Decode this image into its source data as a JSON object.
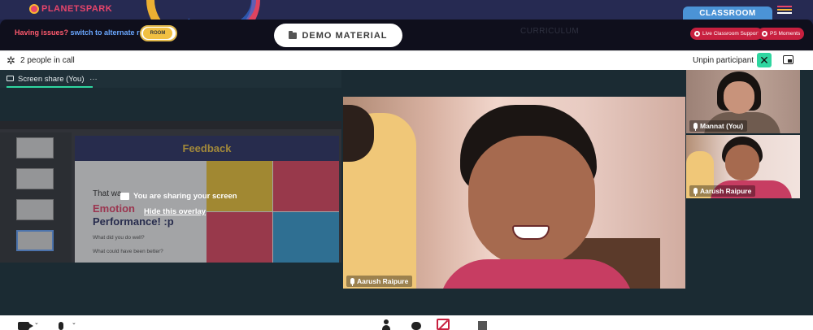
{
  "brand": {
    "logo_text": "PLANETSPARK"
  },
  "nav": {
    "classroom_tab": "CLASSROOM"
  },
  "header": {
    "issues_text": "Having issues?",
    "switch_text": "switch to alternate room",
    "room_toggle_label": "ROOM",
    "demo_material_label": "DEMO MATERIAL",
    "curriculum_label": "CURRICULUM",
    "live_support_label": "Live Classroom Support",
    "ps_moments_label": "PS Moments"
  },
  "callbar": {
    "people_count": "2 people in call",
    "unpin_label": "Unpin participant"
  },
  "screen_share": {
    "tab_label": "Screen share (You)",
    "more_label": "···",
    "sharing_text": "You are sharing your screen",
    "hide_overlay_text": "Hide this overlay",
    "slide_title": "Feedback",
    "slide_line1": "That wa",
    "slide_line2": "Emotion",
    "slide_line3": "Performance! :p",
    "slide_q1": "What did you do well?",
    "slide_q2": "What could have been better?"
  },
  "participants": [
    {
      "name": "Aarush Raipure"
    },
    {
      "name": "Mannat (You)"
    },
    {
      "name": "Aarush Raipure"
    }
  ],
  "colors": {
    "accent_green": "#2fd6a0",
    "brand_pink": "#e8456b",
    "support_red": "#c8203f"
  },
  "icons": [
    "gear-icon",
    "close-icon",
    "pip-icon",
    "monitor-icon",
    "mic-icon",
    "camera-icon",
    "person-icon",
    "chat-icon",
    "stop-share-icon",
    "grid-icon",
    "folder-icon"
  ]
}
